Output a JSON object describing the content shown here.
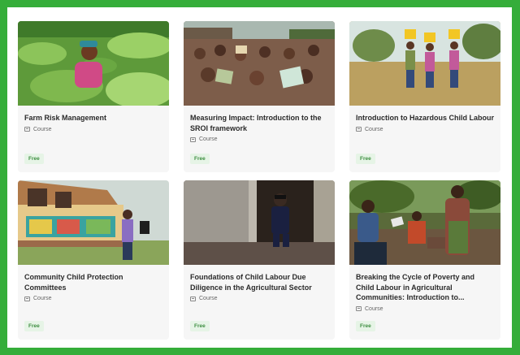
{
  "courses": [
    {
      "title": "Farm Risk Management",
      "type": "Course",
      "price": "Free"
    },
    {
      "title": "Measuring Impact: Introduction to the SROI framework",
      "type": "Course",
      "price": "Free"
    },
    {
      "title": "Introduction to Hazardous Child Labour",
      "type": "Course",
      "price": "Free"
    },
    {
      "title": "Community Child Protection Committees",
      "type": "Course",
      "price": "Free"
    },
    {
      "title": "Foundations of Child Labour Due Diligence in the Agricultural Sector",
      "type": "Course",
      "price": "Free"
    },
    {
      "title": "Breaking the Cycle of Poverty and Child Labour in Agricultural Communities: Introduction to...",
      "type": "Course",
      "price": "Free"
    }
  ],
  "colors": {
    "frame": "#35ad3a",
    "badge_bg": "#e6f4e6",
    "badge_text": "#3e8e41"
  }
}
